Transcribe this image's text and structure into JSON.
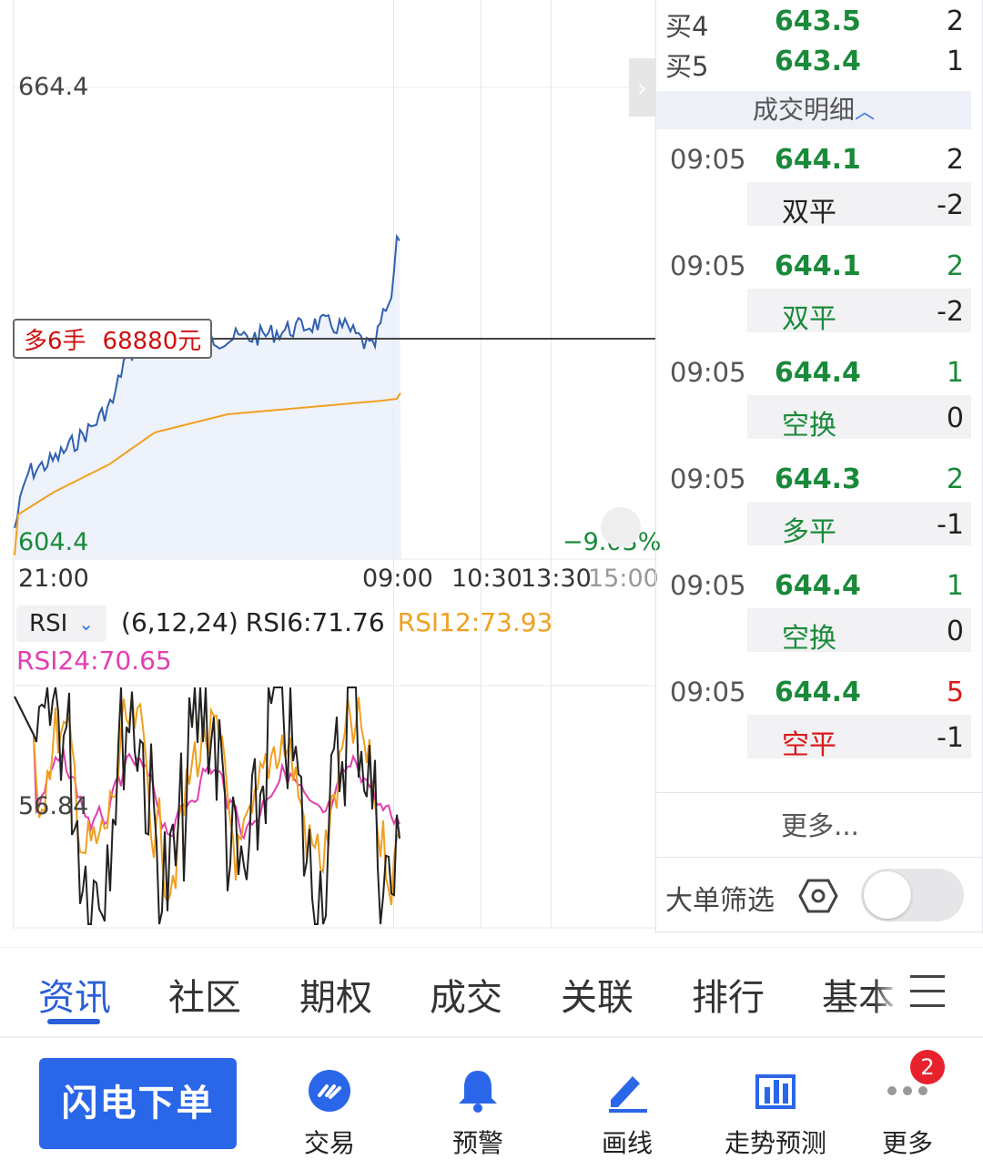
{
  "order_book": {
    "rows": [
      {
        "label": "买4",
        "price": "643.5",
        "qty": "2"
      },
      {
        "label": "买5",
        "price": "643.4",
        "qty": "1"
      }
    ]
  },
  "trade_detail": {
    "header": "成交明细",
    "trades": [
      {
        "time": "09:05",
        "price": "644.1",
        "vol": "2",
        "vol_color": "dark",
        "type": "双平",
        "type_color": "dark",
        "oi": "-2"
      },
      {
        "time": "09:05",
        "price": "644.1",
        "vol": "2",
        "vol_color": "green",
        "type": "双平",
        "type_color": "green",
        "oi": "-2"
      },
      {
        "time": "09:05",
        "price": "644.4",
        "vol": "1",
        "vol_color": "green",
        "type": "空换",
        "type_color": "green",
        "oi": "0"
      },
      {
        "time": "09:05",
        "price": "644.3",
        "vol": "2",
        "vol_color": "green",
        "type": "多平",
        "type_color": "green",
        "oi": "-1"
      },
      {
        "time": "09:05",
        "price": "644.4",
        "vol": "1",
        "vol_color": "green",
        "type": "空换",
        "type_color": "green",
        "oi": "0"
      },
      {
        "time": "09:05",
        "price": "644.4",
        "vol": "5",
        "vol_color": "red",
        "type": "空平",
        "type_color": "red",
        "oi": "-1"
      }
    ],
    "more_label": "更多...",
    "big_order_filter_label": "大单筛选",
    "big_order_filter_on": false
  },
  "price_chart": {
    "y_max_label": "664.4",
    "y_min_label": "604.4",
    "change_label": "−9.03%",
    "position_tag": {
      "direction": "多6手",
      "amount": "68880元"
    },
    "time_labels": [
      "21:00",
      "09:00",
      "10:30",
      "13:30",
      "15:00"
    ]
  },
  "rsi": {
    "dropdown_value": "RSI",
    "params": "(6,12,24)",
    "rsi6_label": "RSI6:71.76",
    "rsi12_label": "RSI12:73.93",
    "rsi24_label": "RSI24:70.65",
    "level_label": "56.84"
  },
  "tabs": [
    {
      "label": "资讯",
      "active": true
    },
    {
      "label": "社区",
      "active": false
    },
    {
      "label": "期权",
      "active": false
    },
    {
      "label": "成交",
      "active": false
    },
    {
      "label": "关联",
      "active": false
    },
    {
      "label": "排行",
      "active": false
    },
    {
      "label": "基本",
      "active": false
    }
  ],
  "toolbar": {
    "flash_order_label": "闪电下单",
    "items": [
      {
        "label": "交易",
        "icon": "trade-icon"
      },
      {
        "label": "预警",
        "icon": "bell-icon"
      },
      {
        "label": "画线",
        "icon": "draw-line-icon"
      },
      {
        "label": "走势预测",
        "icon": "trend-forecast-icon"
      },
      {
        "label": "更多",
        "icon": "more-dots-icon"
      }
    ],
    "more_badge": "2"
  },
  "colors": {
    "accent_blue": "#2a66e8",
    "up_red": "#d81818",
    "down_green": "#1a8a3a",
    "price_line": "#3060b0",
    "avg_line": "#f0a020",
    "rsi6": "#222222",
    "rsi12": "#f0a020",
    "rsi24": "#e040b0"
  }
}
